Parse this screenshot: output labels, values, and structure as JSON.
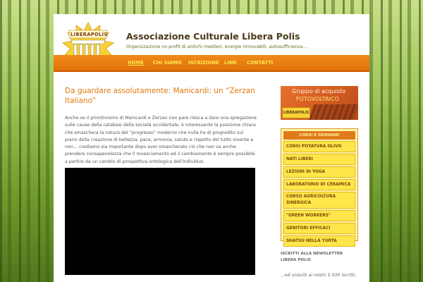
{
  "site": {
    "title": "Associazione Culturale Libera Polis",
    "description": "Organizzazione no profit di antichi mestieri, energie rinnovabili, autosufficienza...",
    "logo_text": "LIBERAPOLIS"
  },
  "nav": {
    "items": [
      {
        "label": "HOME",
        "active": true
      },
      {
        "label": "CHI SIAMO"
      },
      {
        "label": "ISCRIZIONE"
      },
      {
        "label": "LINK"
      },
      {
        "label": "CONTATTI"
      }
    ]
  },
  "post": {
    "title": "Da guardare assolutamente: Manicardi: un “Zerzan Italiano”",
    "body": "Anche se il primitivismo di Manicardi e Zerzan non pare riesca a dare una spiegazione sulle cause della catabasi della società occidentale, è interessante la posizione chiara che smaschera la natura del “progresso” moderno che nulla ha di progredito sul piano della creazione di bellezza, pace, armonia, salute e rispetto del tutto vivente e non… crediamo sia importante dopo aver smascherato ciò che non va anche prendere consapevolezza che il rovesciamento ed il cambiamento è sempre possibile a partire da un cambio di prospettiva ontologica dell'individuo."
  },
  "banner": {
    "line1": "Gruppo di acquisto",
    "line2": "FOTOVOLTAICO",
    "logo_text": "LIBERAPOLIS"
  },
  "sidebar_menu": {
    "heading": "CORSI E SEMINARI",
    "items": [
      "CORSI POTATURA OLIVO",
      "NATI LIBERI",
      "LEZIONI DI YOGA",
      "LABORATORIO DI CERAMICA",
      "CORSO AGRICOLTURA SINERGICA",
      "\"GREEN WORKERS\"",
      "GENITORI EFFICACI",
      "SHATSU NELLA YURTA"
    ]
  },
  "newsletter": {
    "heading": "ISCRITTI ALLA NEWSLETTER LIBERA POLIS",
    "text": "...ed unisciti ai nostri 2.430 iscritti."
  },
  "colors": {
    "accent_orange": "#e0780a",
    "nav_text": "#ffe84a",
    "menu_yellow": "#ffe64a"
  }
}
